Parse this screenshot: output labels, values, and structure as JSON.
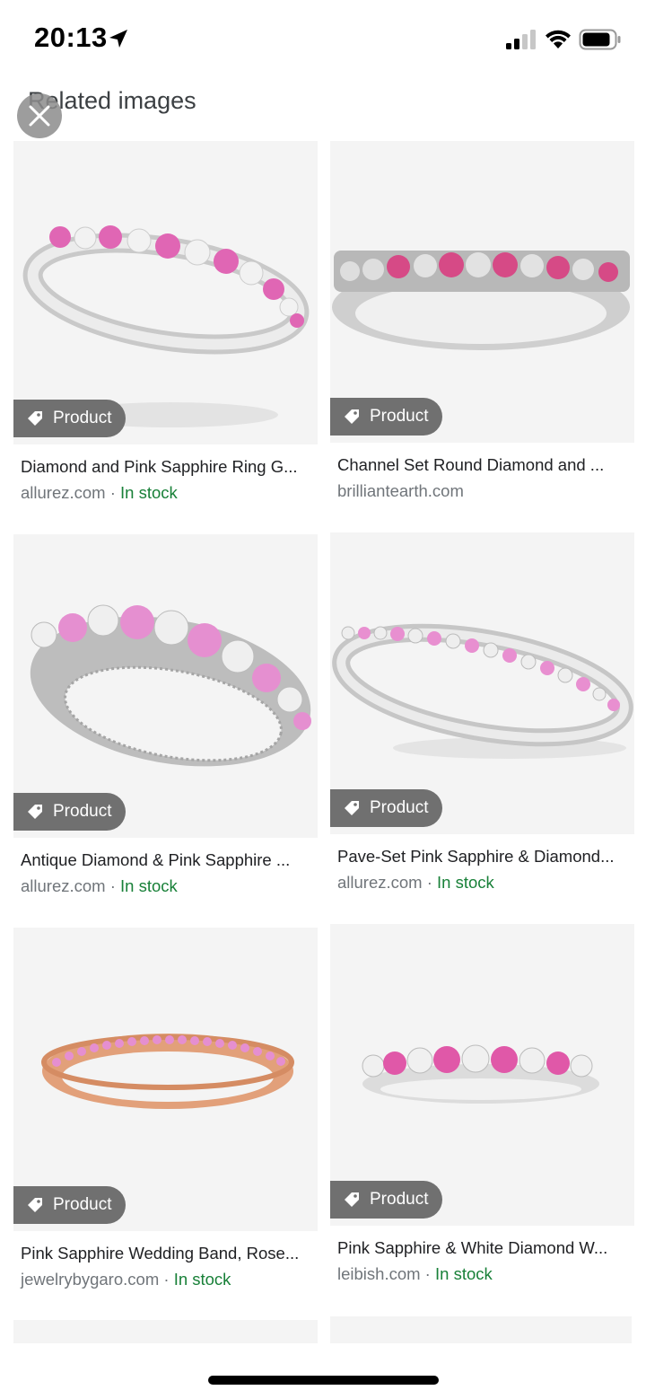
{
  "status_bar": {
    "time": "20:13"
  },
  "header": {
    "title": "Related images"
  },
  "badge_label": "Product",
  "cards": [
    {
      "title": "Diamond and Pink Sapphire Ring G...",
      "source": "allurez.com",
      "separator": " · ",
      "stock": "In stock"
    },
    {
      "title": "Channel Set Round Diamond and ...",
      "source": "brilliantearth.com",
      "separator": "",
      "stock": ""
    },
    {
      "title": "Antique Diamond & Pink Sapphire ...",
      "source": "allurez.com",
      "separator": " · ",
      "stock": "In stock"
    },
    {
      "title": "Pave-Set Pink Sapphire & Diamond...",
      "source": "allurez.com",
      "separator": " · ",
      "stock": "In stock"
    },
    {
      "title": "Pink Sapphire Wedding Band, Rose...",
      "source": "jewelrybygaro.com",
      "separator": " · ",
      "stock": "In stock"
    },
    {
      "title": "Pink Sapphire & White Diamond W...",
      "source": "leibish.com",
      "separator": " · ",
      "stock": "In stock"
    }
  ],
  "icons": {
    "location": "location-arrow-icon",
    "signal": "cellular-signal-icon",
    "wifi": "wifi-icon",
    "battery": "battery-icon",
    "close": "close-icon",
    "tag": "price-tag-icon"
  },
  "colors": {
    "in_stock": "#188038",
    "source": "#70757a",
    "badge_bg": "#707070",
    "pink_stone": "#e066b4",
    "rose_gold": "#e2a07a"
  }
}
